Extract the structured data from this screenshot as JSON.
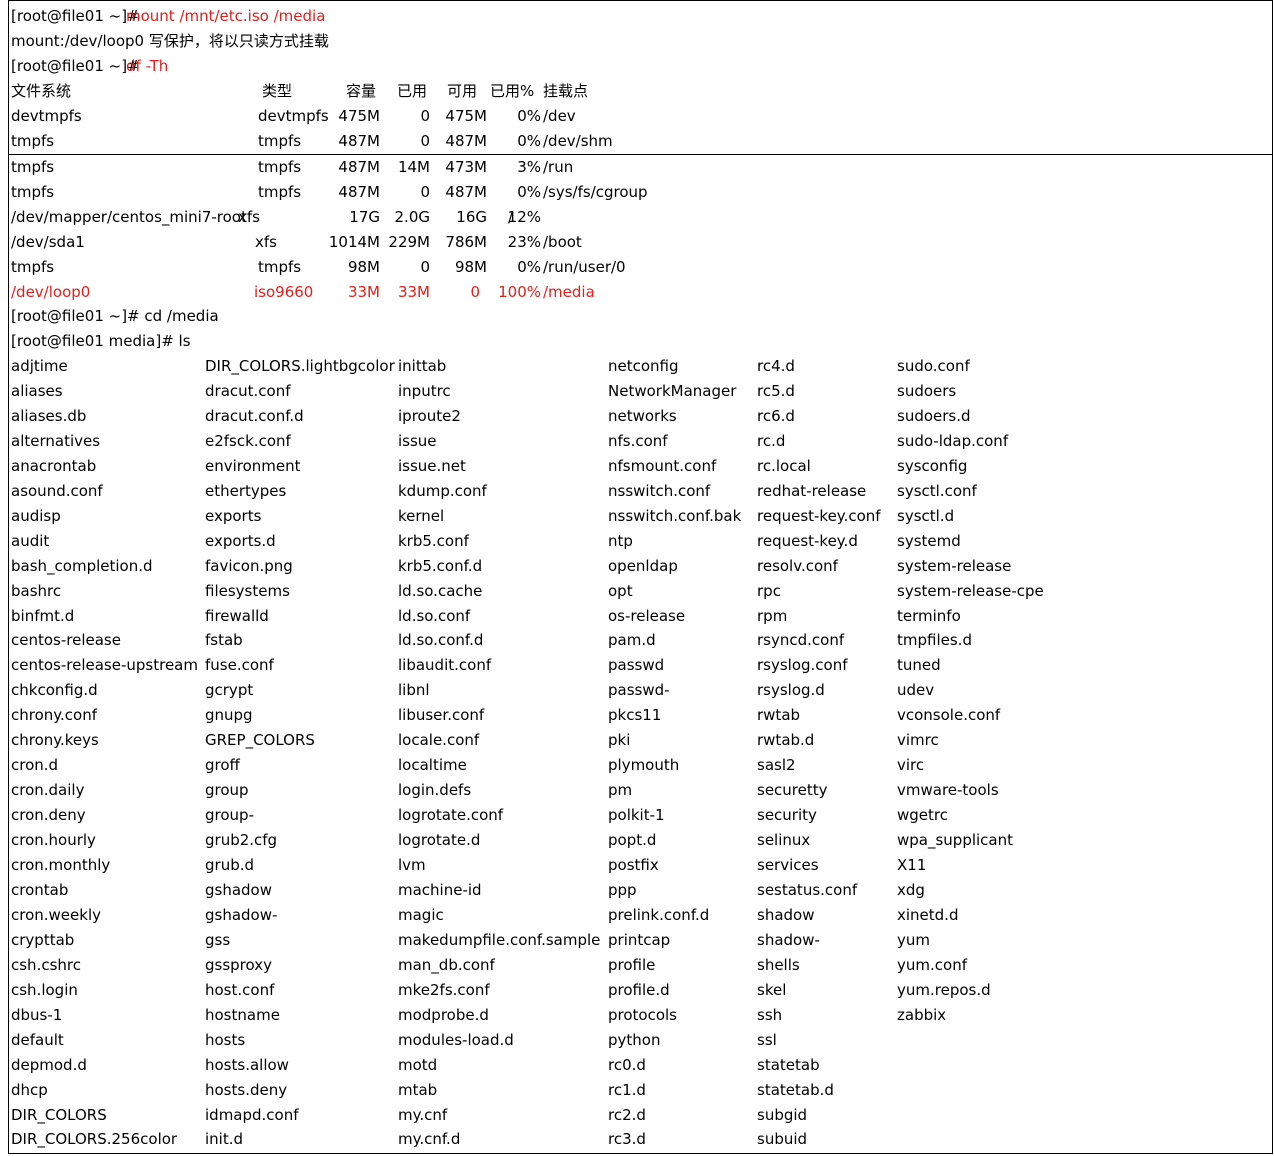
{
  "lines": [
    [
      "[root@file01 ~]# ",
      "mount /mnt/etc.iso /media"
    ],
    [
      "mount:/dev/loop0 写保护，将以只读方式挂载"
    ],
    [
      "[root@file01 ~]# ",
      "df -Th"
    ]
  ],
  "df": {
    "header": [
      "文件系统",
      "类型",
      "容量",
      "已用",
      "可用",
      "已用%",
      "挂载点"
    ],
    "rows": [
      [
        "devtmpfs",
        "devtmpfs",
        "475M",
        "0",
        "475M",
        "0%",
        "/dev"
      ],
      [
        "tmpfs",
        "tmpfs",
        "487M",
        "0",
        "487M",
        "0%",
        "/dev/shm"
      ],
      [
        "tmpfs",
        "tmpfs",
        "487M",
        "14M",
        "473M",
        "3%",
        "/run"
      ],
      [
        "tmpfs",
        "tmpfs",
        "487M",
        "0",
        "487M",
        "0%",
        "/sys/fs/cgroup"
      ],
      [
        "/dev/mapper/centos_mini7-root",
        "xfs",
        "17G",
        "2.0G",
        "16G",
        "12%",
        "/"
      ],
      [
        "/dev/sda1",
        "xfs",
        "1014M",
        "229M",
        "786M",
        "23%",
        "/boot"
      ],
      [
        "tmpfs",
        "tmpfs",
        "98M",
        "0",
        "98M",
        "0%",
        "/run/user/0"
      ],
      [
        "/dev/loop0",
        "iso9660",
        "33M",
        "33M",
        "0",
        "100%",
        "/media"
      ]
    ]
  },
  "after_df": [
    "[root@file01 ~]# cd /media",
    "[root@file01 media]# ls"
  ],
  "ls_rows": [
    [
      "adjtime",
      "DIR_COLORS.lightbgcolor",
      "inittab",
      "netconfig",
      "rc4.d",
      "sudo.conf"
    ],
    [
      "aliases",
      "dracut.conf",
      "inputrc",
      "NetworkManager",
      "rc5.d",
      "sudoers"
    ],
    [
      "aliases.db",
      "dracut.conf.d",
      "iproute2",
      "networks",
      "rc6.d",
      "sudoers.d"
    ],
    [
      "alternatives",
      "e2fsck.conf",
      "issue",
      "nfs.conf",
      "rc.d",
      "sudo-ldap.conf"
    ],
    [
      "anacrontab",
      "environment",
      "issue.net",
      "nfsmount.conf",
      "rc.local",
      "sysconfig"
    ],
    [
      "asound.conf",
      "ethertypes",
      "kdump.conf",
      "nsswitch.conf",
      "redhat-release",
      "sysctl.conf"
    ],
    [
      "audisp",
      "exports",
      "kernel",
      "nsswitch.conf.bak",
      "request-key.conf",
      "sysctl.d"
    ],
    [
      "audit",
      "exports.d",
      "krb5.conf",
      "ntp",
      "request-key.d",
      "systemd"
    ],
    [
      "bash_completion.d",
      "favicon.png",
      "krb5.conf.d",
      "openldap",
      "resolv.conf",
      "system-release"
    ],
    [
      "bashrc",
      "filesystems",
      "ld.so.cache",
      "opt",
      "rpc",
      "system-release-cpe"
    ],
    [
      "binfmt.d",
      "firewalld",
      "ld.so.conf",
      "os-release",
      "rpm",
      "terminfo"
    ],
    [
      "centos-release",
      "fstab",
      "ld.so.conf.d",
      "pam.d",
      "rsyncd.conf",
      "tmpfiles.d"
    ],
    [
      "centos-release-upstream",
      "fuse.conf",
      "libaudit.conf",
      "passwd",
      "rsyslog.conf",
      "tuned"
    ],
    [
      "chkconfig.d",
      "gcrypt",
      "libnl",
      "passwd-",
      "rsyslog.d",
      "udev"
    ],
    [
      "chrony.conf",
      "gnupg",
      "libuser.conf",
      "pkcs11",
      "rwtab",
      "vconsole.conf"
    ],
    [
      "chrony.keys",
      "GREP_COLORS",
      "locale.conf",
      "pki",
      "rwtab.d",
      "vimrc"
    ],
    [
      "cron.d",
      "groff",
      "localtime",
      "plymouth",
      "sasl2",
      "virc"
    ],
    [
      "cron.daily",
      "group",
      "login.defs",
      "pm",
      "securetty",
      "vmware-tools"
    ],
    [
      "cron.deny",
      "group-",
      "logrotate.conf",
      "polkit-1",
      "security",
      "wgetrc"
    ],
    [
      "cron.hourly",
      "grub2.cfg",
      "logrotate.d",
      "popt.d",
      "selinux",
      "wpa_supplicant"
    ],
    [
      "cron.monthly",
      "grub.d",
      "lvm",
      "postfix",
      "services",
      "X11"
    ],
    [
      "crontab",
      "gshadow",
      "machine-id",
      "ppp",
      "sestatus.conf",
      "xdg"
    ],
    [
      "cron.weekly",
      "gshadow-",
      "magic",
      "prelink.conf.d",
      "shadow",
      "xinetd.d"
    ],
    [
      "crypttab",
      "gss",
      "makedumpfile.conf.sample",
      "printcap",
      "shadow-",
      "yum"
    ],
    [
      "csh.cshrc",
      "gssproxy",
      "man_db.conf",
      "profile",
      "shells",
      "yum.conf"
    ],
    [
      "csh.login",
      "host.conf",
      "mke2fs.conf",
      "profile.d",
      "skel",
      "yum.repos.d"
    ],
    [
      "dbus-1",
      "hostname",
      "modprobe.d",
      "protocols",
      "ssh",
      "zabbix"
    ],
    [
      "default",
      "hosts",
      "modules-load.d",
      "python",
      "ssl",
      ""
    ],
    [
      "depmod.d",
      "hosts.allow",
      "motd",
      "rc0.d",
      "statetab",
      ""
    ],
    [
      "dhcp",
      "hosts.deny",
      "mtab",
      "rc1.d",
      "statetab.d",
      ""
    ],
    [
      "DIR_COLORS",
      "idmapd.conf",
      "my.cnf",
      "rc2.d",
      "subgid",
      ""
    ],
    [
      "DIR_COLORS.256color",
      "init.d",
      "my.cnf.d",
      "rc3.d",
      "subuid",
      ""
    ]
  ],
  "colors": {
    "command": "#e0201c",
    "text": "#000000",
    "border": "#000000"
  }
}
